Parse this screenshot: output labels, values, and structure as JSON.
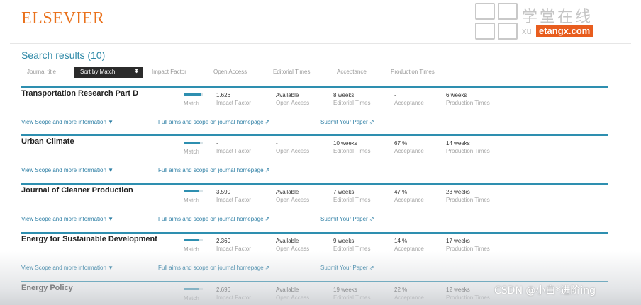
{
  "brand": {
    "logo_text": "ELSEVIER"
  },
  "watermark_top": {
    "cn_text": "学堂在线",
    "prefix": "xu",
    "domain": "etangx.com"
  },
  "watermark_bottom": {
    "text": "CSDN @小白*进阶ing"
  },
  "results": {
    "title": "Search results (10)"
  },
  "sort_bar": {
    "options": {
      "journal_title": "Journal title",
      "match": "Sort by Match",
      "impact": "Impact Factor",
      "open_access": "Open Access",
      "editorial": "Editorial Times",
      "acceptance": "Acceptance",
      "production": "Production Times"
    },
    "caret": "⬍"
  },
  "stat_labels": {
    "match": "Match",
    "impact": "Impact Factor",
    "open_access": "Open Access",
    "editorial": "Editorial Times",
    "acceptance": "Acceptance",
    "production": "Production Times"
  },
  "link_labels": {
    "scope": "View Scope and more information",
    "aims": "Full aims and scope on journal homepage",
    "submit": "Submit Your Paper"
  },
  "icons": {
    "scope_arrow": "▼",
    "external": "⇗"
  },
  "colors": {
    "brand_orange": "#e9711c",
    "accent_blue": "#2e8fb0",
    "link_blue": "#2e7fa5"
  },
  "journals": [
    {
      "name": "Transportation Research Part D",
      "match": 0.9,
      "impact": "1.626",
      "open_access": "Available",
      "editorial": "8 weeks",
      "acceptance": "-",
      "production": "6 weeks",
      "has_submit": true
    },
    {
      "name": "Urban Climate",
      "match": 0.85,
      "impact": "-",
      "open_access": "-",
      "editorial": "10 weeks",
      "acceptance": "67 %",
      "production": "14 weeks",
      "has_submit": false
    },
    {
      "name": "Journal of Cleaner Production",
      "match": 0.8,
      "impact": "3.590",
      "open_access": "Available",
      "editorial": "7 weeks",
      "acceptance": "47 %",
      "production": "23 weeks",
      "has_submit": true
    },
    {
      "name": "Energy for Sustainable Development",
      "match": 0.8,
      "impact": "2.360",
      "open_access": "Available",
      "editorial": "9 weeks",
      "acceptance": "14 %",
      "production": "17 weeks",
      "has_submit": true
    },
    {
      "name": "Energy Policy",
      "match": 0.8,
      "impact": "2.696",
      "open_access": "Available",
      "editorial": "19 weeks",
      "acceptance": "22 %",
      "production": "12 weeks",
      "has_submit": false
    }
  ]
}
